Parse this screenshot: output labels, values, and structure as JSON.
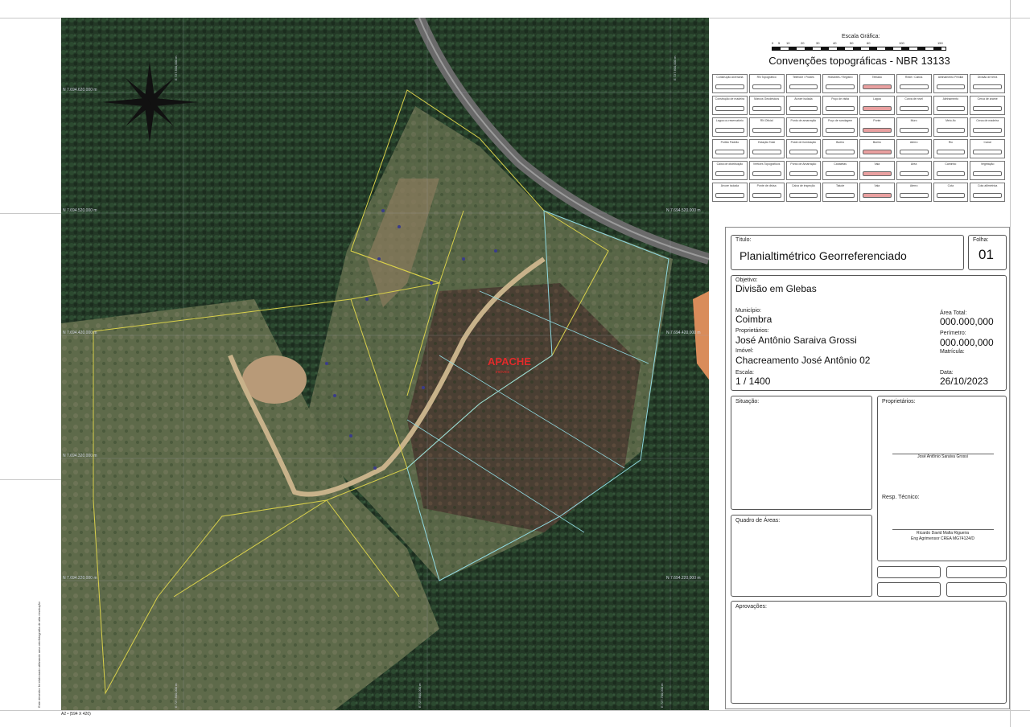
{
  "map": {
    "north_arrow": "compass-rose-icon",
    "watermark": "APACHE",
    "watermark_sub": "imóveis",
    "grid_labels_left": [
      "N 7.694.620,000 m",
      "N 7.694.520,000 m",
      "N 7.694.420,000 m",
      "N 7.694.320,000 m",
      "N 7.694.220,000 m"
    ],
    "grid_labels_right": [
      "N 7.694.520,000 m",
      "N 7.694.420,000 m",
      "N 7.694.220,000 m"
    ],
    "grid_labels_top": [
      "E 727.500,000 m",
      "E 727.600,000 m"
    ],
    "grid_labels_bottom": [
      "E 727.500,000 m",
      "E 727.600,000 m",
      "E 727.700,000 m"
    ],
    "sheet_size": "A2 • (594 X 420)",
    "side_note": "Este desenho foi elaborado utilizando uma ortofotografia de alta resolução"
  },
  "legend": {
    "scale_title": "Escala Gráfica:",
    "scale_ticks": [
      "0",
      "5",
      "10",
      "20",
      "30",
      "40",
      "50",
      "60",
      "100",
      "150"
    ],
    "title": "Convenções topográficas - NBR 13133",
    "cells": [
      "Construção Alvenaria",
      "RN Topográfico",
      "Telefone / Postes",
      "Hidrantes / Registro",
      "Telhado",
      "Rede / Cabos",
      "Alinhamento Predial",
      "Divisão de terra",
      "Construção de madeira",
      "Marcos Geodésicos",
      "Árvore isolada",
      "Poço de visita",
      "Lagoa",
      "Curva de nível",
      "Alinhamento",
      "Cerca de arame",
      "Lagoa ou reservatório",
      "RN Oficial",
      "Ponto de amarração",
      "Poço de sondagem",
      "Ponte",
      "Muro",
      "Meio-fio",
      "Cerca de madeira",
      "Portão Padrão",
      "Estação Total",
      "Poste de iluminação",
      "Bueiro",
      "Bueiro",
      "Aterro",
      "Rio",
      "Canal",
      "Caixa de distribuição",
      "Vértices Topográficos",
      "Ponto de Amarração",
      "Canaletas",
      "Vala",
      "Área",
      "Caminho",
      "Vegetação",
      "Árvore isolada",
      "Ponte de divisa",
      "Caixa de inspeção",
      "Talude",
      "Vala",
      "Aterro",
      "Cota",
      "Cota altimétrica"
    ]
  },
  "title_block": {
    "titulo_label": "Título:",
    "titulo_value": "Planialtimétrico Georreferenciado",
    "folha_label": "Folha:",
    "folha_value": "01",
    "objetivo_label": "Objetivo:",
    "objetivo_value": "Divisão em Glebas",
    "municipio_label": "Município:",
    "municipio_value": "Coimbra",
    "area_label": "Área Total:",
    "area_value": "000.000,000",
    "proprietario_label": "Proprietários:",
    "proprietario_value": "José Antônio Saraiva Grossi",
    "perimetro_label": "Perímetro:",
    "perimetro_value": "000.000,000",
    "imovel_label": "Imóvel:",
    "imovel_value": "Chacreamento José Antônio 02",
    "matricula_label": "Matrícula:",
    "escala_label": "Escala:",
    "escala_value": "1 / 1400",
    "data_label": "Data:",
    "data_value": "26/10/2023",
    "situacao_label": "Situação:",
    "proprietarios_label": "Proprietários:",
    "proprietarios_sig": "José Antônio Saraiva Grossi",
    "resp_label": "Resp. Técnico:",
    "resp_name": "Ricardo David Mafia Rigueira",
    "resp_cred": "Eng Agrimensor CREA MG74124/D",
    "quadro_label": "Quadro de Áreas:",
    "aprov_label": "Aprovações:"
  }
}
